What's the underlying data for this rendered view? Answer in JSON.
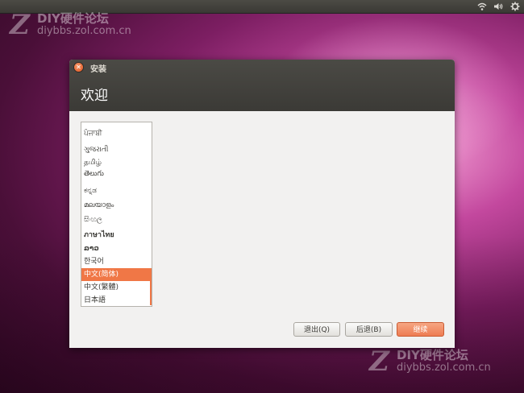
{
  "watermark": {
    "logo": "Z",
    "title": "DIY硬件论坛",
    "url": "diybbs.zol.com.cn"
  },
  "panel": {
    "icons": [
      "wifi-icon",
      "volume-icon",
      "gear-icon"
    ]
  },
  "window": {
    "title": "安装",
    "heading": "欢迎"
  },
  "languages": [
    "ਪੰਜਾਬੀ",
    "ગુજરાતી",
    "தமிழ்",
    "తెలుగు",
    "ಕನ್ನಡ",
    "മലയാളം",
    "සිංහල",
    "ภาษาไทย",
    "ລາວ",
    "한국어",
    "中文(简体)",
    "中文(繁體)",
    "日本語"
  ],
  "selected_language": "中文(简体)",
  "buttons": {
    "quit": "退出(Q)",
    "back": "后退(B)",
    "continue": "继续"
  },
  "colors": {
    "accent": "#f07746",
    "titlebar": "#3b3a36",
    "window_bg": "#f2f1f0"
  }
}
